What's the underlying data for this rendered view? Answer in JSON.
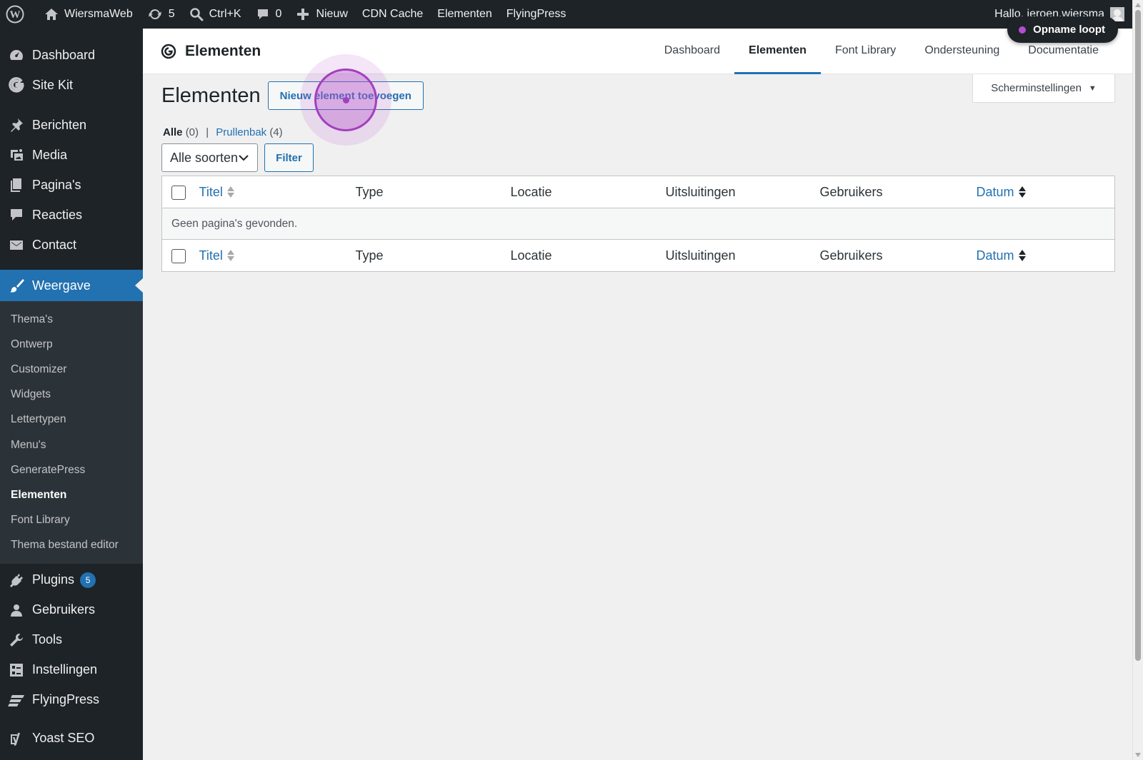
{
  "adminbar": {
    "site_name": "WiersmaWeb",
    "updates_count": "5",
    "search_shortcut": "Ctrl+K",
    "comments_count": "0",
    "new_label": "Nieuw",
    "cdn_cache": "CDN Cache",
    "elementen": "Elementen",
    "flyingpress": "FlyingPress",
    "greeting": "Hallo, jeroen.wiersma"
  },
  "recording": {
    "label": "Opname loopt",
    "dot_color": "#b24fd1"
  },
  "sidebar": {
    "top_items": [
      {
        "label": "Dashboard",
        "icon": "dashboard-icon"
      },
      {
        "label": "Site Kit",
        "icon": "google-g-icon"
      }
    ],
    "items": [
      {
        "label": "Berichten",
        "icon": "pin-icon"
      },
      {
        "label": "Media",
        "icon": "media-icon"
      },
      {
        "label": "Pagina's",
        "icon": "pages-icon"
      },
      {
        "label": "Reacties",
        "icon": "comment-icon"
      },
      {
        "label": "Contact",
        "icon": "envelope-icon"
      }
    ],
    "active": {
      "label": "Weergave",
      "icon": "paintbrush-icon"
    },
    "submenu": [
      "Thema's",
      "Ontwerp",
      "Customizer",
      "Widgets",
      "Lettertypen",
      "Menu's",
      "GeneratePress",
      "Elementen",
      "Font Library",
      "Thema bestand editor"
    ],
    "submenu_current": "Elementen",
    "bottom_items": [
      {
        "label": "Plugins",
        "icon": "plugin-icon",
        "badge": "5"
      },
      {
        "label": "Gebruikers",
        "icon": "users-icon"
      },
      {
        "label": "Tools",
        "icon": "wrench-icon"
      },
      {
        "label": "Instellingen",
        "icon": "settings-icon"
      },
      {
        "label": "FlyingPress",
        "icon": "flyingpress-icon"
      },
      {
        "label": "Yoast SEO",
        "icon": "yoast-icon"
      }
    ],
    "accent": "#2271b1"
  },
  "gp_header": {
    "title": "Elementen",
    "tabs": [
      "Dashboard",
      "Elementen",
      "Font Library",
      "Ondersteuning",
      "Documentatie"
    ],
    "active_tab": "Elementen"
  },
  "main": {
    "screen_options": "Scherminstellingen",
    "page_title": "Elementen",
    "add_button": "Nieuw element toevoegen",
    "views": {
      "all_label": "Alle",
      "all_count": "(0)",
      "separator": "|",
      "trash_label": "Prullenbak",
      "trash_count": "(4)"
    },
    "filter_select": "Alle soorten",
    "filter_button": "Filter",
    "table": {
      "columns": [
        "Titel",
        "Type",
        "Locatie",
        "Uitsluitingen",
        "Gebruikers",
        "Datum"
      ],
      "empty_message": "Geen pagina's gevonden."
    }
  }
}
